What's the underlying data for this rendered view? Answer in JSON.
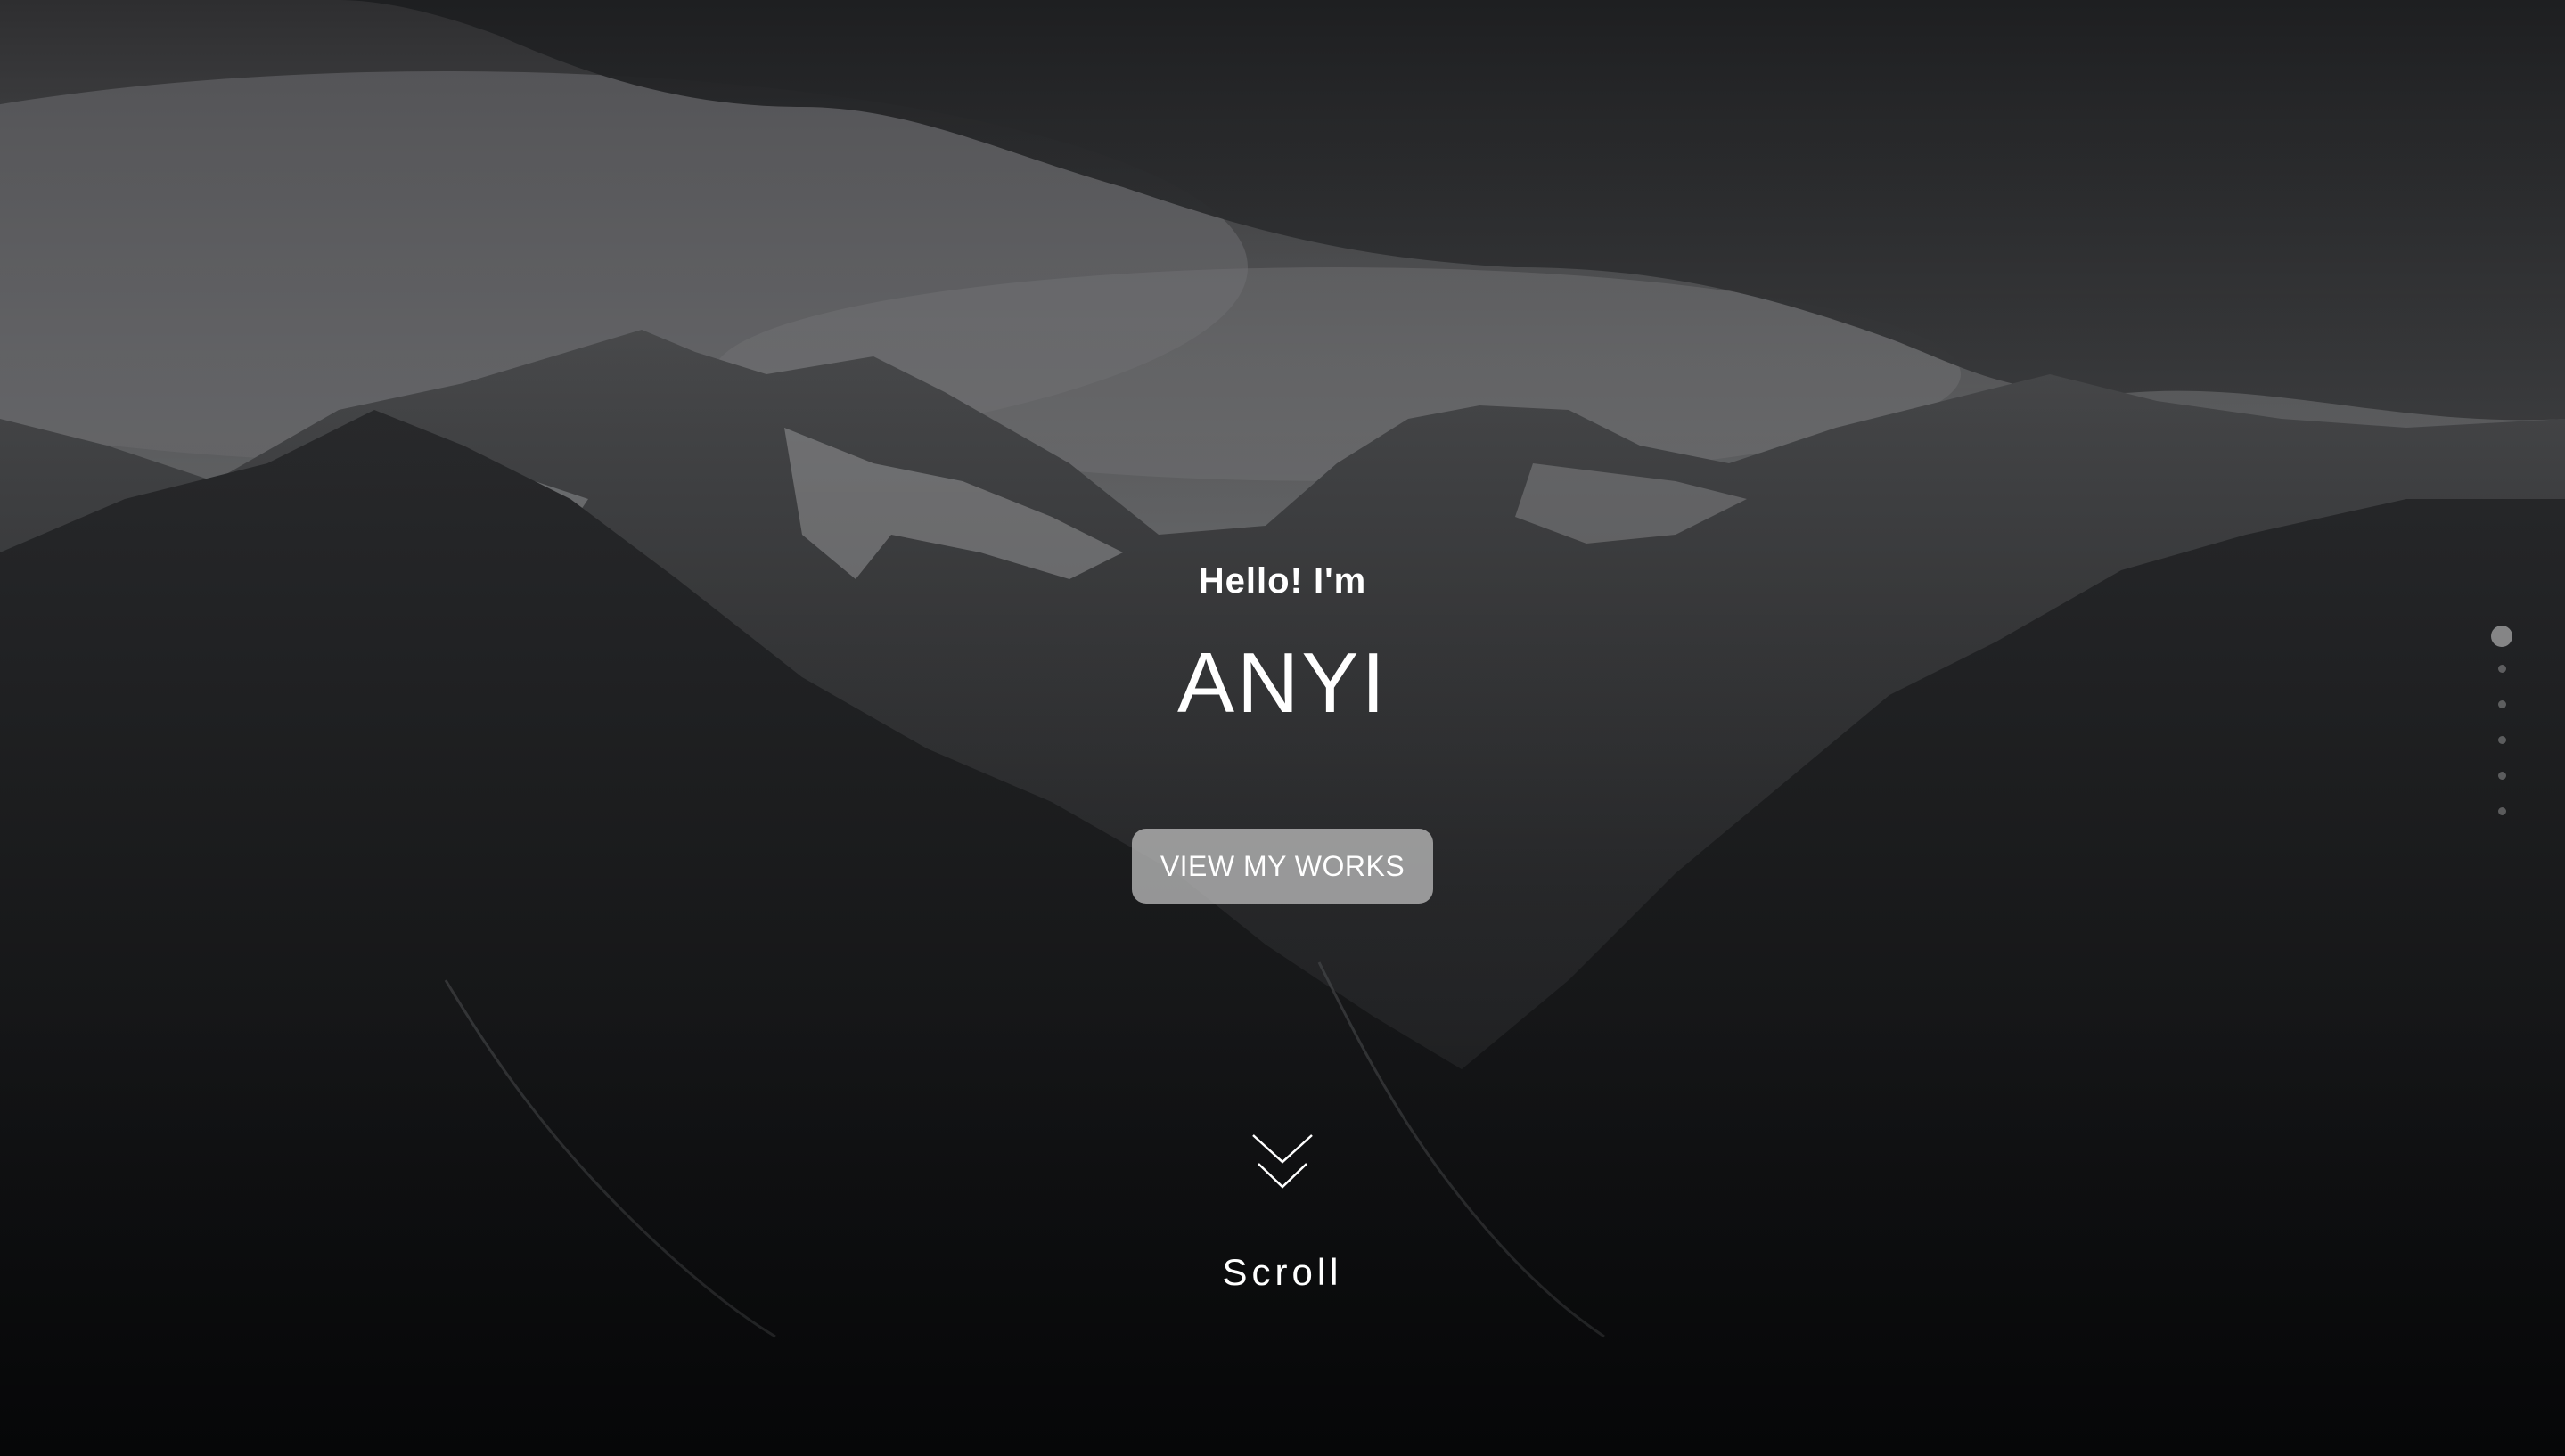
{
  "hero": {
    "greeting": "Hello! I'm",
    "name": "ANYI",
    "cta_label": "VIEW MY WORKS",
    "scroll_label": "Scroll",
    "scroll_icon": "chevron-double-down-icon",
    "section_dots": [
      {
        "name": "section-dot-1",
        "active": true
      },
      {
        "name": "section-dot-2",
        "active": false
      },
      {
        "name": "section-dot-3",
        "active": false
      },
      {
        "name": "section-dot-4",
        "active": false
      },
      {
        "name": "section-dot-5",
        "active": false
      },
      {
        "name": "section-dot-6",
        "active": false
      }
    ]
  },
  "colors": {
    "text": "#ffffff",
    "button_bg": "#b9b9b9",
    "background": "#0c0d0f"
  }
}
